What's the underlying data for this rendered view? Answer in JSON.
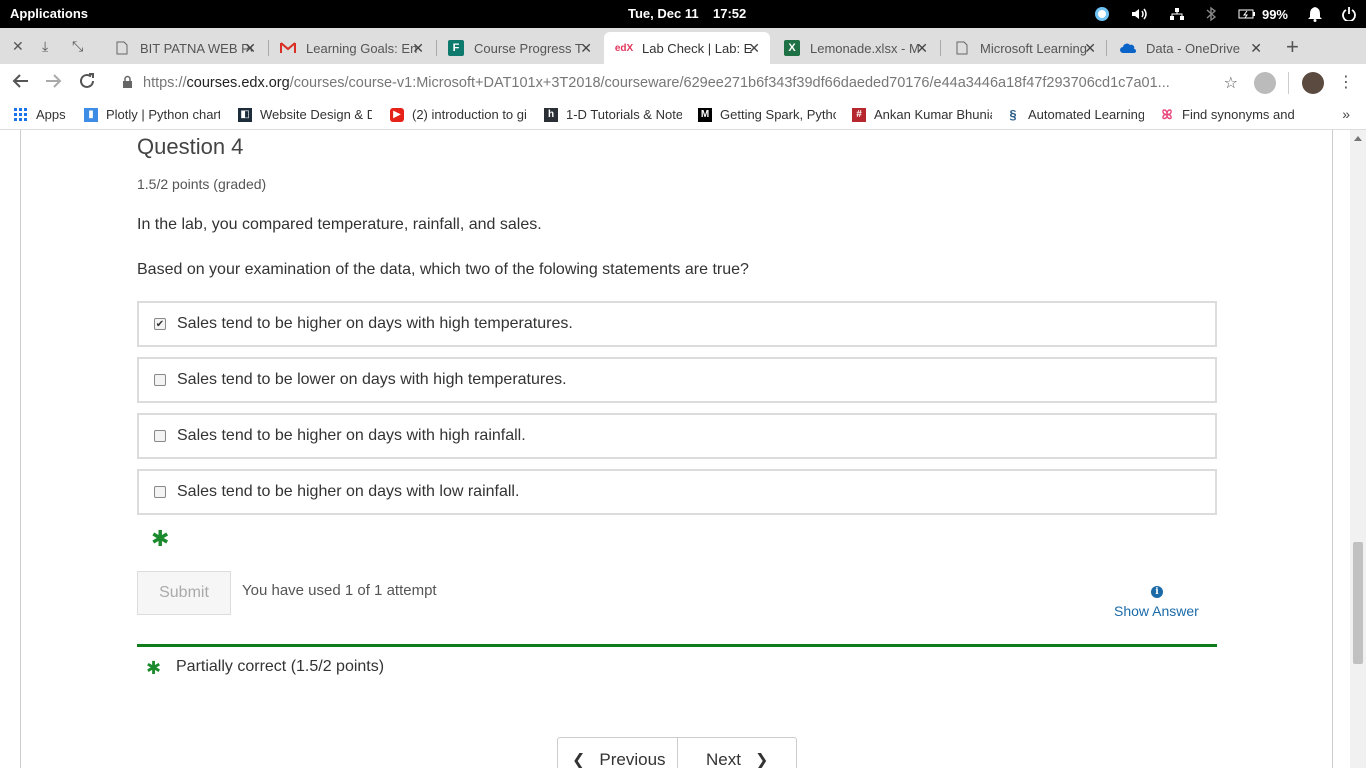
{
  "system_bar": {
    "applications": "Applications",
    "datetime": "Tue, Dec 11    17:52",
    "battery": "99%",
    "icons": [
      "skype-icon",
      "volume-icon",
      "network-icon",
      "bluetooth-icon",
      "battery-icon",
      "bell-icon",
      "power-icon"
    ]
  },
  "tabs": [
    {
      "title": "BIT PATNA WEB PO",
      "icon": "doc",
      "active": false
    },
    {
      "title": "Learning Goals: En",
      "icon": "gmail",
      "active": false
    },
    {
      "title": "Course Progress T",
      "icon": "forms",
      "active": false
    },
    {
      "title": "Lab Check | Lab: E",
      "icon": "edx",
      "active": true
    },
    {
      "title": "Lemonade.xlsx - M",
      "icon": "excel",
      "active": false
    },
    {
      "title": "Microsoft Learning",
      "icon": "doc",
      "active": false
    },
    {
      "title": "Data - OneDrive",
      "icon": "onedrive",
      "active": false
    }
  ],
  "address_bar": {
    "scheme": "https://",
    "domain": "courses.edx.org",
    "path": "/courses/course-v1:Microsoft+DAT101x+3T2018/courseware/629ee271b6f343f39df66daeded70176/e44a3446a18f47f293706cd1c7a01..."
  },
  "bookmarks": [
    {
      "label": "Apps",
      "icon": "apps-grid"
    },
    {
      "label": "Plotly | Python chart",
      "icon": "plotly"
    },
    {
      "label": "Website Design & D",
      "icon": "website"
    },
    {
      "label": "(2) introduction to gi",
      "icon": "youtube"
    },
    {
      "label": "1-D Tutorials & Note",
      "icon": "h"
    },
    {
      "label": "Getting Spark, Pytho",
      "icon": "medium"
    },
    {
      "label": "Ankan Kumar Bhunia",
      "icon": "hash"
    },
    {
      "label": "Automated Learning",
      "icon": "auto"
    },
    {
      "label": "Find synonyms and",
      "icon": "synonyms"
    }
  ],
  "question": {
    "title": "Question 4",
    "points": "1.5/2 points (graded)",
    "intro": "In the lab, you compared temperature, rainfall, and sales.",
    "prompt": "Based on your examination of the data, which two of the folowing statements are true?",
    "options": [
      {
        "label": "Sales tend to be higher on days with high temperatures.",
        "checked": true
      },
      {
        "label": "Sales tend to be lower on days with high temperatures.",
        "checked": false
      },
      {
        "label": "Sales tend to be higher on days with high rainfall.",
        "checked": false
      },
      {
        "label": "Sales tend to be higher on days with low rainfall.",
        "checked": false
      }
    ],
    "submit_label": "Submit",
    "attempts_text": "You have used 1 of 1 attempt",
    "show_answer_label": "Show Answer",
    "result_text": "Partially correct (1.5/2 points)"
  },
  "pagination": {
    "previous_label": "Previous",
    "next_label": "Next"
  },
  "colors": {
    "correct_green": "#0f7d1b",
    "link_blue": "#1b6aa8"
  }
}
